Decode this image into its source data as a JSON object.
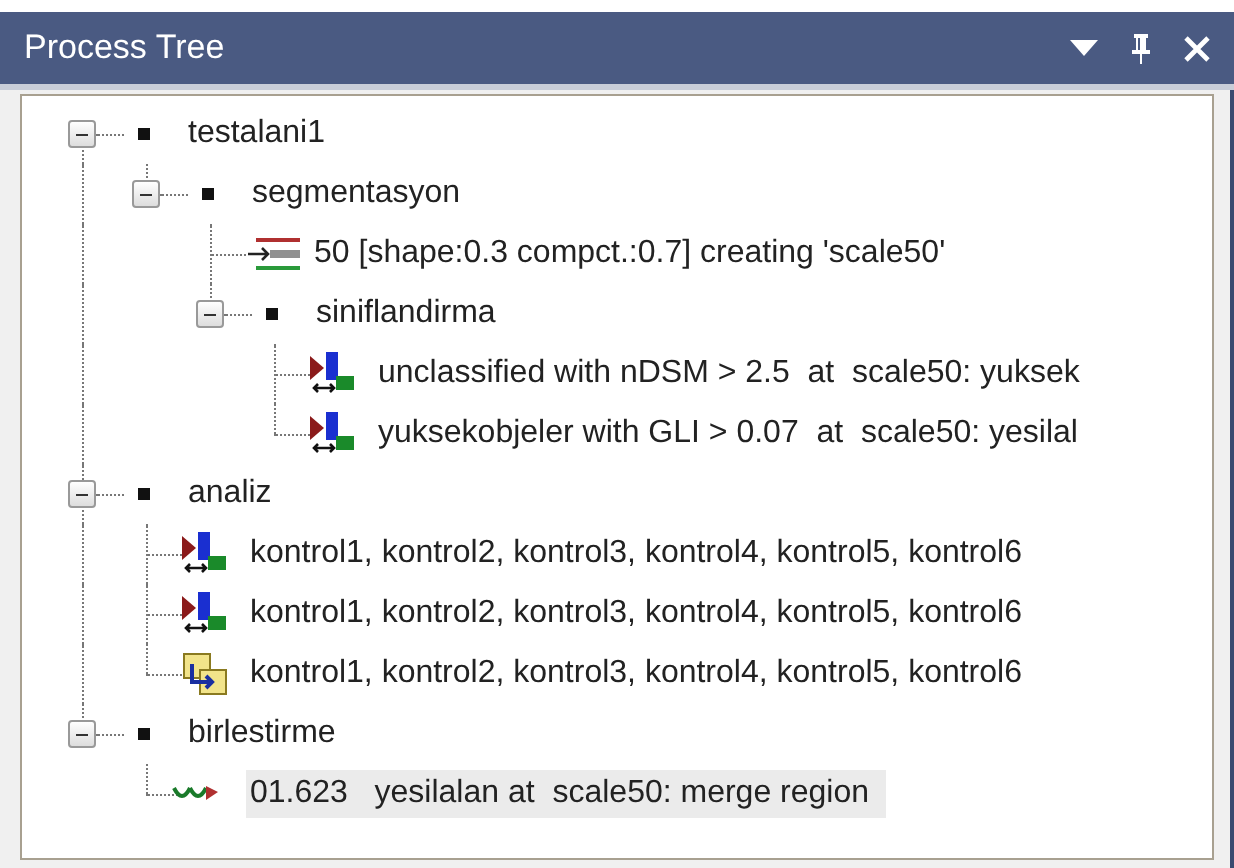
{
  "window": {
    "title": "Process Tree"
  },
  "tree": [
    {
      "kind": "folder",
      "label": "testalani1",
      "expanded": true,
      "selected": false,
      "children": [
        {
          "kind": "folder",
          "label": "segmentasyon",
          "expanded": true,
          "selected": false,
          "children": [
            {
              "kind": "segmentation",
              "label": "50 [shape:0.3 compct.:0.7] creating 'scale50'",
              "selected": false
            },
            {
              "kind": "folder",
              "label": "siniflandirma",
              "expanded": true,
              "selected": false,
              "children": [
                {
                  "kind": "classification",
                  "label": "unclassified with nDSM > 2.5  at  scale50: yuksek",
                  "selected": false
                },
                {
                  "kind": "classification",
                  "label": "yuksekobjeler with GLI > 0.07  at  scale50: yesilal",
                  "selected": false
                }
              ]
            }
          ]
        }
      ]
    },
    {
      "kind": "folder",
      "label": "analiz",
      "expanded": true,
      "selected": false,
      "children": [
        {
          "kind": "classification",
          "label": "kontrol1, kontrol2, kontrol3, kontrol4, kontrol5, kontrol6",
          "selected": false
        },
        {
          "kind": "classification",
          "label": "kontrol1, kontrol2, kontrol3, kontrol4, kontrol5, kontrol6",
          "selected": false
        },
        {
          "kind": "assignment",
          "label": "kontrol1, kontrol2, kontrol3, kontrol4, kontrol5, kontrol6",
          "selected": false
        }
      ]
    },
    {
      "kind": "folder",
      "label": "birlestirme",
      "expanded": true,
      "selected": false,
      "children": [
        {
          "kind": "merge",
          "label": "01.623   yesilalan at  scale50: merge region",
          "selected": true
        }
      ]
    }
  ]
}
